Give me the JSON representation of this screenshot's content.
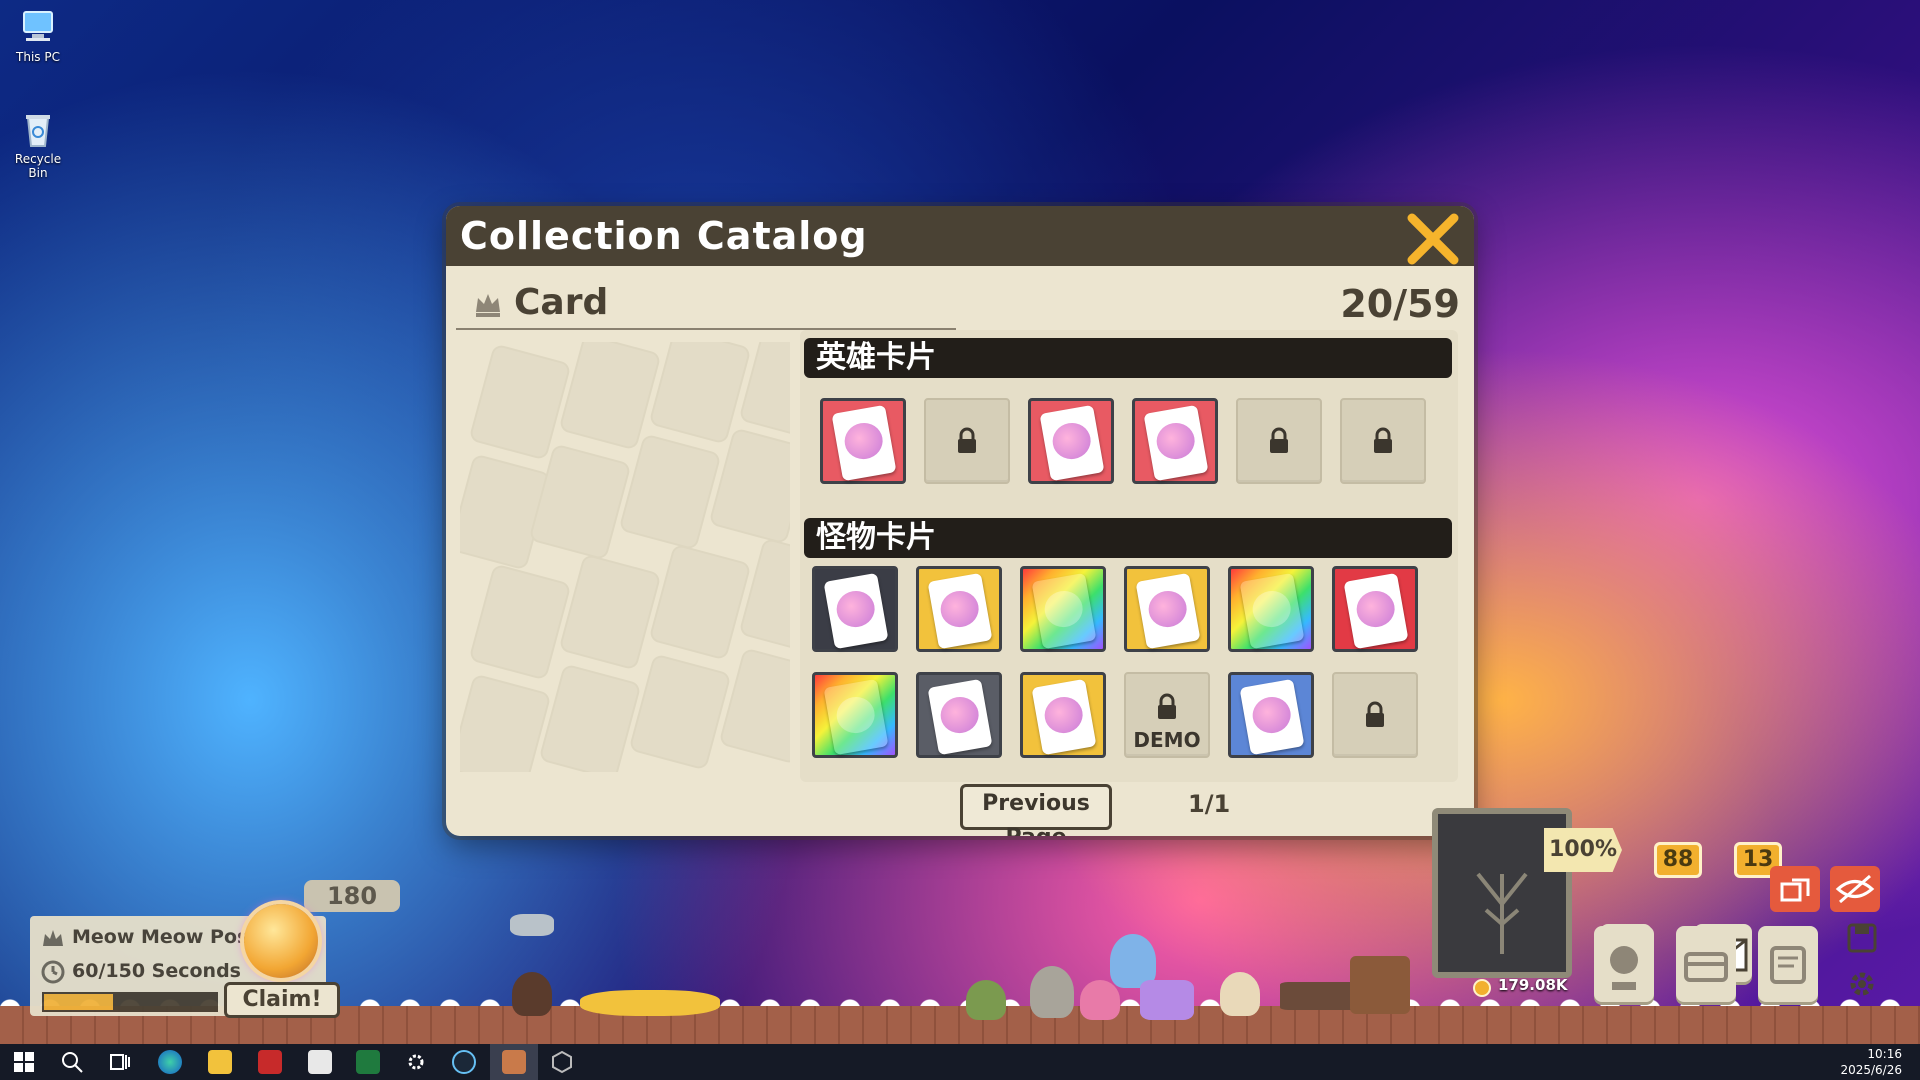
{
  "desktop": {
    "icons": [
      {
        "label": "This PC"
      },
      {
        "label": "Recycle Bin"
      }
    ]
  },
  "dialog": {
    "title": "Collection Catalog",
    "section": "Card",
    "count": "20/59",
    "hero_group": "英雄卡片",
    "monster_group": "怪物卡片",
    "hero_slots": [
      {
        "state": "owned",
        "bg": "#e85a63"
      },
      {
        "state": "locked"
      },
      {
        "state": "owned",
        "bg": "#e85a63"
      },
      {
        "state": "owned",
        "bg": "#e85a63"
      },
      {
        "state": "locked"
      },
      {
        "state": "locked"
      }
    ],
    "monster_slots_row1": [
      {
        "state": "owned",
        "bg": "#3b3d46"
      },
      {
        "state": "owned",
        "bg": "#f2c23c"
      },
      {
        "state": "owned",
        "bg": "rainbow"
      },
      {
        "state": "owned",
        "bg": "#f2c23c"
      },
      {
        "state": "owned",
        "bg": "rainbow"
      },
      {
        "state": "owned",
        "bg": "#e23a45"
      }
    ],
    "monster_slots_row2": [
      {
        "state": "owned",
        "bg": "rainbow"
      },
      {
        "state": "owned",
        "bg": "#5a5d66"
      },
      {
        "state": "owned",
        "bg": "#f2c23c"
      },
      {
        "state": "locked",
        "label": "DEMO"
      },
      {
        "state": "owned",
        "bg": "#5c86d6"
      },
      {
        "state": "locked"
      }
    ],
    "prev_button": "Previous Page",
    "page": "1/1"
  },
  "post": {
    "title": "Meow Meow Post",
    "timer": "60/150 Seconds",
    "progress": 0.4,
    "coin_count": "180",
    "claim": "Claim!"
  },
  "hud": {
    "zoom": "100%",
    "quest_badge": "88",
    "mail_badge": "13",
    "gold": "179.08K"
  },
  "taskbar": {
    "time": "10:16",
    "date": "2025/6/26"
  }
}
